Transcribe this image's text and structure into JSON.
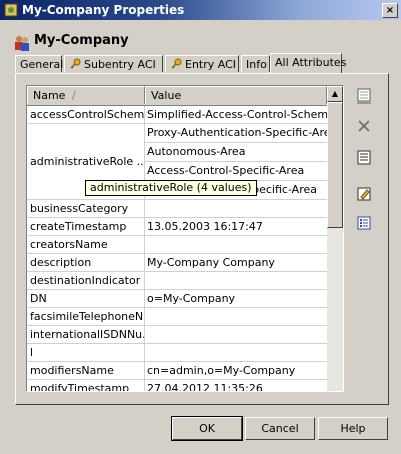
{
  "window": {
    "title": "My-Company Properties",
    "close_glyph": "×",
    "icon": "properties-icon"
  },
  "header": {
    "title": "My-Company",
    "icon": "people-icon"
  },
  "tabs": [
    {
      "label": "General",
      "icon": ""
    },
    {
      "label": "Subentry ACI",
      "icon": "key-icon"
    },
    {
      "label": "Entry ACI",
      "icon": "key-icon"
    },
    {
      "label": "Info",
      "icon": ""
    },
    {
      "label": "All Attributes",
      "icon": "",
      "active": true
    }
  ],
  "table": {
    "columns": [
      "Name",
      "Value"
    ],
    "sort_indicator": "/",
    "rows": [
      {
        "name": "accessControlScheme",
        "value": "Simplified-Access-Control-Scheme"
      },
      {
        "name": "administrativeRole ...",
        "values": [
          "Proxy-Authentication-Specific-Area",
          "Autonomous-Area",
          "Access-Control-Specific-Area",
          "Specific-Area"
        ]
      },
      {
        "name": "businessCategory",
        "value": ""
      },
      {
        "name": "createTimestamp",
        "value": "13.05.2003 16:17:47"
      },
      {
        "name": "creatorsName",
        "value": ""
      },
      {
        "name": "description",
        "value": "My-Company Company"
      },
      {
        "name": "destinationIndicator",
        "value": ""
      },
      {
        "name": "DN",
        "value": "o=My-Company"
      },
      {
        "name": "facsimileTelephoneN...",
        "value": ""
      },
      {
        "name": "internationalISDNNu...",
        "value": ""
      },
      {
        "name": "l",
        "value": ""
      },
      {
        "name": "modifiersName",
        "value": "cn=admin,o=My-Company"
      },
      {
        "name": "modifyTimestamp",
        "value": "27.04.2012 11:35:26"
      }
    ],
    "tooltip": "administrativeRole    (4 values)"
  },
  "side_buttons": [
    "view-icon",
    "delete-icon",
    "list-icon",
    "edit-icon",
    "properties-list-icon"
  ],
  "buttons": {
    "ok": "OK",
    "cancel": "Cancel",
    "help": "Help"
  },
  "scrollbar": {
    "up_glyph": "▲"
  }
}
